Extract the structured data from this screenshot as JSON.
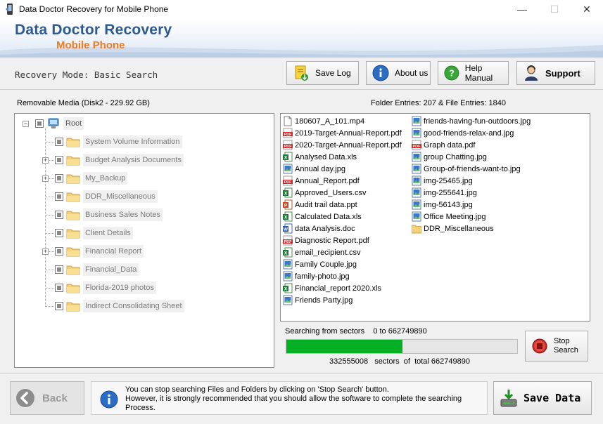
{
  "window": {
    "title": "Data Doctor Recovery for Mobile Phone",
    "minimize": "—",
    "maximize": "☐",
    "close": "✕"
  },
  "brand": {
    "main": "Data Doctor Recovery",
    "sub": "Mobile Phone"
  },
  "toolbar": {
    "mode": "Recovery Mode: Basic Search",
    "save_log": "Save Log",
    "about_us": "About us",
    "help_manual": "Help Manual",
    "support": "Support"
  },
  "info": {
    "media": "Removable Media (Disk2 - 229.92 GB)",
    "entries": "Folder Entries: 207 & File Entries: 1840"
  },
  "tree": {
    "root": "Root",
    "items": [
      {
        "label": "System Volume Information",
        "expandable": false
      },
      {
        "label": "Budget Analysis Documents",
        "expandable": true
      },
      {
        "label": "My_Backup",
        "expandable": true
      },
      {
        "label": "DDR_Miscellaneous",
        "expandable": false
      },
      {
        "label": "Business Sales Notes",
        "expandable": false
      },
      {
        "label": "Client Details",
        "expandable": false
      },
      {
        "label": "Financial Report",
        "expandable": true
      },
      {
        "label": "Financial_Data",
        "expandable": false
      },
      {
        "label": "Florida-2019 photos",
        "expandable": false
      },
      {
        "label": "Indirect Consolidating Sheet",
        "expandable": false
      }
    ]
  },
  "files": {
    "column1": [
      {
        "name": "180607_A_101.mp4",
        "icon": "file-icon"
      },
      {
        "name": "2019-Target-Annual-Report.pdf",
        "icon": "pdf-icon"
      },
      {
        "name": "2020-Target-Annual-Report.pdf",
        "icon": "pdf-icon"
      },
      {
        "name": "Analysed Data.xls",
        "icon": "excel-icon"
      },
      {
        "name": "Annual day.jpg",
        "icon": "image-icon"
      },
      {
        "name": "Annual_Report.pdf",
        "icon": "pdf-icon"
      },
      {
        "name": "Approved_Users.csv",
        "icon": "excel-icon"
      },
      {
        "name": "Audit trail data.ppt",
        "icon": "powerpoint-icon"
      },
      {
        "name": "Calculated Data.xls",
        "icon": "excel-icon"
      },
      {
        "name": "data Analysis.doc",
        "icon": "word-icon"
      },
      {
        "name": "Diagnostic Report.pdf",
        "icon": "pdf-icon"
      },
      {
        "name": "email_recipient.csv",
        "icon": "excel-icon"
      },
      {
        "name": "Family Couple.jpg",
        "icon": "image-icon"
      },
      {
        "name": "family-photo.jpg",
        "icon": "image-icon"
      },
      {
        "name": "Financial_report 2020.xls",
        "icon": "excel-icon"
      },
      {
        "name": "Friends Party.jpg",
        "icon": "image-icon"
      }
    ],
    "column2": [
      {
        "name": "friends-having-fun-outdoors.jpg",
        "icon": "image-icon"
      },
      {
        "name": "good-friends-relax-and.jpg",
        "icon": "image-icon"
      },
      {
        "name": "Graph data.pdf",
        "icon": "pdf-icon"
      },
      {
        "name": "group Chatting.jpg",
        "icon": "image-icon"
      },
      {
        "name": "Group-of-friends-want-to.jpg",
        "icon": "image-icon"
      },
      {
        "name": "img-25465.jpg",
        "icon": "image-icon"
      },
      {
        "name": "img-255641.jpg",
        "icon": "image-icon"
      },
      {
        "name": "img-56143.jpg",
        "icon": "image-icon"
      },
      {
        "name": "Office Meeting.jpg",
        "icon": "image-icon"
      },
      {
        "name": "DDR_Miscellaneous",
        "icon": "folder-icon"
      }
    ]
  },
  "search": {
    "label": "Searching from sectors    0 to 662749890",
    "progress_fraction": 0.502,
    "sectors": "332555008   sectors  of  total 662749890",
    "stop_line1": "Stop",
    "stop_line2": "Search"
  },
  "bottom": {
    "back": "Back",
    "notice_line1": "You can stop searching Files and Folders by clicking on 'Stop Search' button.",
    "notice_line2": "However, it is strongly recommended that you should allow the software to complete the searching",
    "notice_line3": "Process.",
    "save_data": "Save Data"
  }
}
